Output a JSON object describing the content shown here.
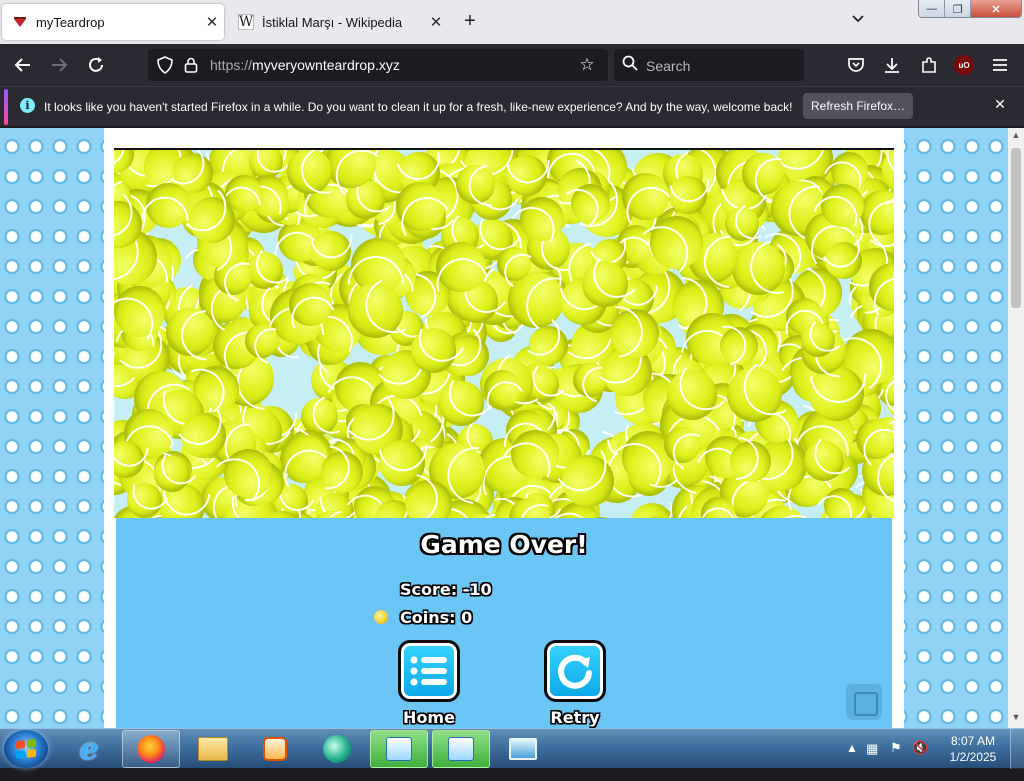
{
  "browser": {
    "tabs": [
      {
        "title": "myTeardrop",
        "favicon": "teardrop-favicon",
        "active": true
      },
      {
        "title": "İstiklal Marşı - Wikipedia",
        "favicon": "W",
        "active": false
      }
    ],
    "url_proto": "https://",
    "url_host": "myveryownteardrop.xyz",
    "search_placeholder": "Search",
    "ublock_badge": "uO"
  },
  "notification": {
    "message": "It looks like you haven't started Firefox in a while. Do you want to clean it up for a fresh, like-new experience? And by the way, welcome back!",
    "button": "Refresh Firefox…"
  },
  "game": {
    "title": "Game Over!",
    "score_label": "Score:",
    "score": "-10",
    "coins_label": "Coins:",
    "coins": "0",
    "home_label": "Home",
    "retry_label": "Retry",
    "ball_color": "#dff11c",
    "panel_color": "#6cc6f5"
  },
  "taskbar": {
    "time": "8:07 AM",
    "date": "1/2/2025"
  }
}
